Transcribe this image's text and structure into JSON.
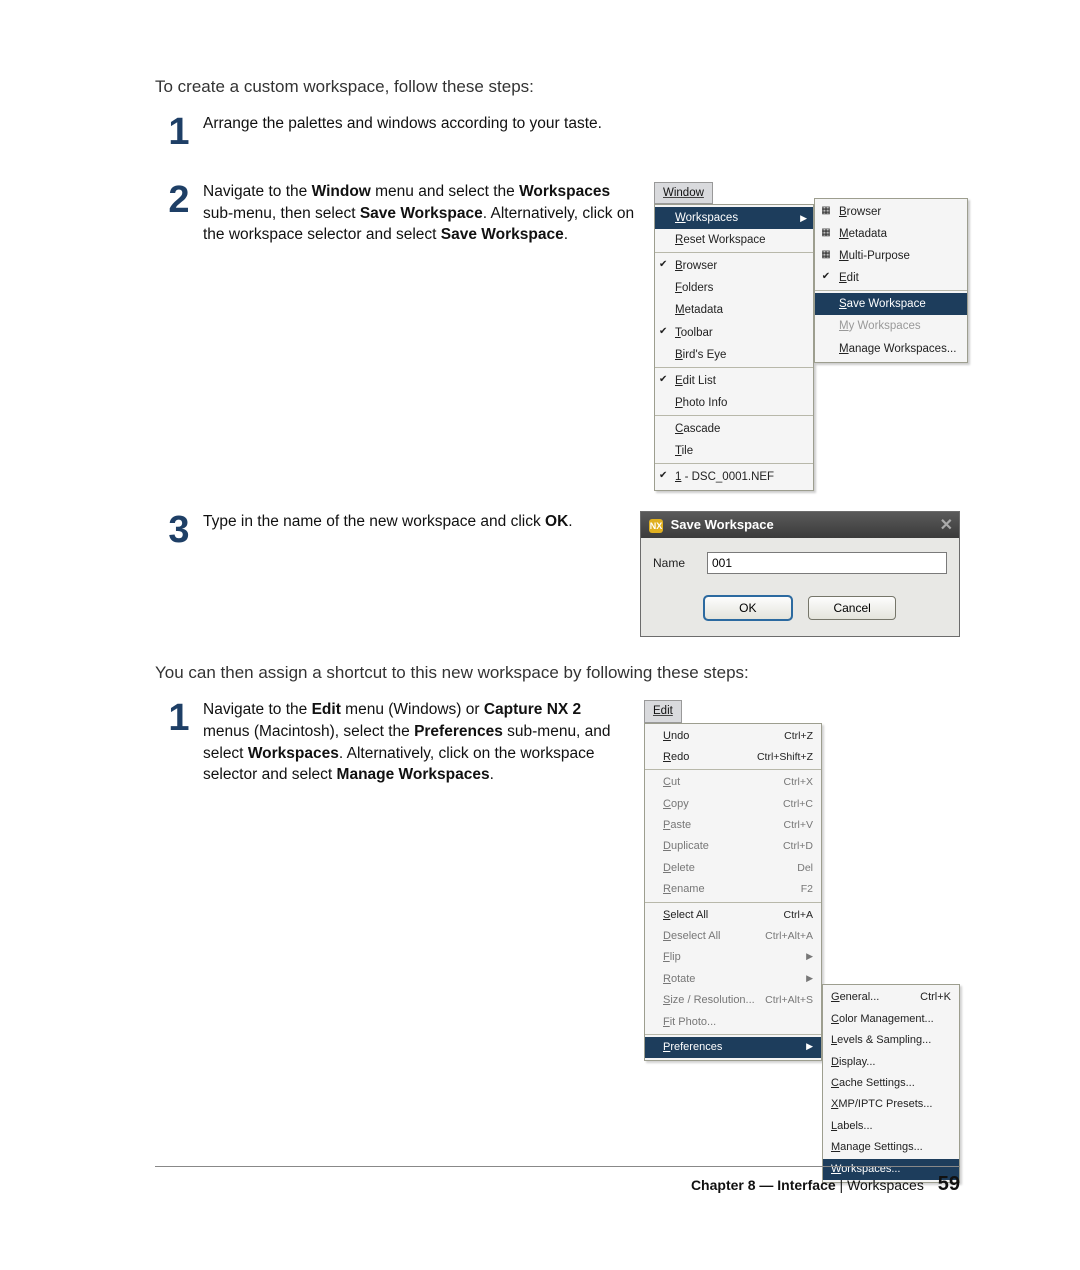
{
  "page": {
    "intro1": "To create a custom workspace, follow these steps:",
    "intro2": "You can then assign a shortcut to this new workspace by following these steps:",
    "footer_chapter": "Chapter 8 — Interface",
    "footer_sep": " | ",
    "footer_section": "Workspaces",
    "footer_pagenum": "59"
  },
  "stepsA": {
    "s1": {
      "num": "1",
      "text": "Arrange the palettes and windows according to your taste."
    },
    "s2": {
      "num": "2",
      "html": "Navigate to the <b>Window</b> menu and select the <b>Workspaces</b> sub-menu, then select <b>Save Workspace</b>. Alternatively, click on the workspace selector and select <b>Save Workspace</b>."
    },
    "s3": {
      "num": "3",
      "html": "Type in the name of the new workspace and click <b>OK</b>."
    }
  },
  "stepsB": {
    "s1": {
      "num": "1",
      "html": "Navigate to the <b>Edit</b> menu (Windows) or <b>Capture NX 2</b> menus (Macintosh), select the <b>Preferences</b> sub-menu, and select <b>Workspaces</b>. Alternatively, click on the workspace selector and select <b>Manage Workspaces</b>."
    }
  },
  "windowMenu": {
    "bar": "Window",
    "items": [
      {
        "label": "Workspaces",
        "checked": false,
        "submenu": true,
        "highlighted": true
      },
      {
        "label": "Reset Workspace",
        "checked": false,
        "sepAfter": true
      },
      {
        "label": "Browser",
        "checked": true
      },
      {
        "label": "Folders",
        "checked": false
      },
      {
        "label": "Metadata",
        "checked": false
      },
      {
        "label": "Toolbar",
        "checked": true
      },
      {
        "label": "Bird's Eye",
        "checked": false,
        "sepAfter": true
      },
      {
        "label": "Edit List",
        "checked": true
      },
      {
        "label": "Photo Info",
        "checked": false,
        "sepAfter": true
      },
      {
        "label": "Cascade",
        "checked": false
      },
      {
        "label": "Tile",
        "checked": false,
        "sepAfter": true
      },
      {
        "label": "1 - DSC_0001.NEF",
        "checked": true
      }
    ],
    "sub": [
      {
        "label": "Browser",
        "icon": "grid-icon"
      },
      {
        "label": "Metadata",
        "icon": "list-icon"
      },
      {
        "label": "Multi-Purpose",
        "icon": "panel-icon"
      },
      {
        "label": "Edit",
        "icon": "edit-icon",
        "checked": true,
        "sepAfter": true
      },
      {
        "label": "Save Workspace",
        "highlighted": true
      },
      {
        "label": "My Workspaces",
        "disabled": true
      },
      {
        "label": "Manage Workspaces..."
      }
    ]
  },
  "dialog": {
    "title": "Save Workspace",
    "appIconText": "NX",
    "nameLabel": "Name",
    "nameValue": "001",
    "ok": "OK",
    "cancel": "Cancel"
  },
  "editMenu": {
    "bar": "Edit",
    "items": [
      {
        "label": "Undo",
        "sc": "Ctrl+Z",
        "en": true
      },
      {
        "label": "Redo",
        "sc": "Ctrl+Shift+Z",
        "en": true,
        "sepAfter": true
      },
      {
        "label": "Cut",
        "sc": "Ctrl+X"
      },
      {
        "label": "Copy",
        "sc": "Ctrl+C"
      },
      {
        "label": "Paste",
        "sc": "Ctrl+V"
      },
      {
        "label": "Duplicate",
        "sc": "Ctrl+D"
      },
      {
        "label": "Delete",
        "sc": "Del"
      },
      {
        "label": "Rename",
        "sc": "F2",
        "sepAfter": true
      },
      {
        "label": "Select All",
        "sc": "Ctrl+A",
        "en": true
      },
      {
        "label": "Deselect All",
        "sc": "Ctrl+Alt+A"
      },
      {
        "label": "Flip",
        "arrow": true
      },
      {
        "label": "Rotate",
        "arrow": true
      },
      {
        "label": "Size / Resolution...",
        "sc": "Ctrl+Alt+S"
      },
      {
        "label": "Fit Photo...",
        "sepAfter": true
      },
      {
        "label": "Preferences",
        "arrow": true,
        "highlighted": true,
        "en": true
      }
    ],
    "prefSub": [
      {
        "label": "General...",
        "sc": "Ctrl+K"
      },
      {
        "label": "Color Management..."
      },
      {
        "label": "Levels & Sampling..."
      },
      {
        "label": "Display..."
      },
      {
        "label": "Cache Settings..."
      },
      {
        "label": "XMP/IPTC Presets..."
      },
      {
        "label": "Labels..."
      },
      {
        "label": "Manage Settings..."
      },
      {
        "label": "Workspaces...",
        "highlighted": true
      }
    ]
  }
}
